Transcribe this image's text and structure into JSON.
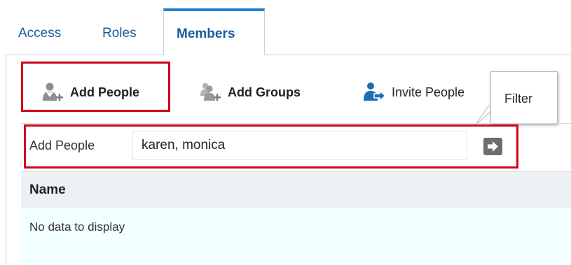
{
  "tabs": [
    {
      "label": "Access"
    },
    {
      "label": "Roles"
    },
    {
      "label": "Members",
      "active": true
    }
  ],
  "toolbar": {
    "add_people_label": "Add People",
    "add_groups_label": "Add Groups",
    "invite_people_label": "Invite People",
    "add_people_icon": "person-add-icon",
    "add_groups_icon": "group-add-icon",
    "invite_people_icon": "person-invite-icon"
  },
  "tooltip": {
    "text": "Filter"
  },
  "filter": {
    "label": "Add People",
    "value": "karen, monica",
    "go_icon": "arrow-right-icon"
  },
  "table": {
    "columns": [
      "Name"
    ],
    "empty_text": "No data to display"
  },
  "colors": {
    "tab_text": "#1a5b9c",
    "active_tab_accent": "#1f7fc7",
    "highlight": "#d0021b",
    "table_body_bg": "#f1ffff",
    "invite_icon": "#1a6fb5"
  }
}
